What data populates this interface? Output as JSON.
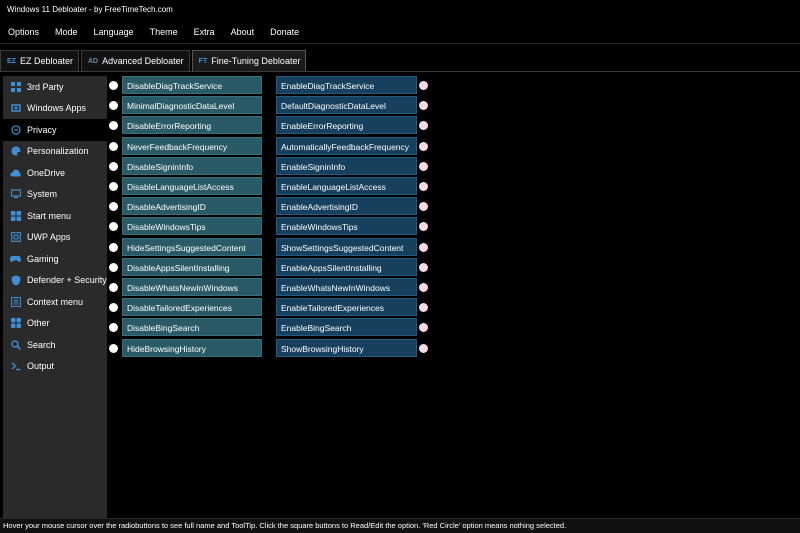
{
  "window": {
    "title": "Windows 11 Debloater - by FreeTimeTech.com"
  },
  "menu": [
    "Options",
    "Mode",
    "Language",
    "Theme",
    "Extra",
    "About",
    "Donate"
  ],
  "tabs": [
    {
      "icon": "EZ",
      "label": "EZ Debloater",
      "active": false
    },
    {
      "icon": "AD",
      "label": "Advanced Debloater",
      "active": false
    },
    {
      "icon": "FT",
      "label": "Fine-Tuning Debloater",
      "active": true
    }
  ],
  "sidebar": {
    "items": [
      {
        "label": "3rd Party",
        "icon": "apps-icon",
        "active": false
      },
      {
        "label": "Windows Apps",
        "icon": "windows-apps-icon",
        "active": false
      },
      {
        "label": "Privacy",
        "icon": "privacy-icon",
        "active": true
      },
      {
        "label": "Personalization",
        "icon": "personalization-icon",
        "active": false
      },
      {
        "label": "OneDrive",
        "icon": "cloud-icon",
        "active": false
      },
      {
        "label": "System",
        "icon": "system-icon",
        "active": false
      },
      {
        "label": "Start menu",
        "icon": "start-menu-icon",
        "active": false
      },
      {
        "label": "UWP Apps",
        "icon": "uwp-apps-icon",
        "active": false
      },
      {
        "label": "Gaming",
        "icon": "gamepad-icon",
        "active": false
      },
      {
        "label": "Defender + Security",
        "icon": "shield-icon",
        "active": false
      },
      {
        "label": "Context menu",
        "icon": "context-menu-icon",
        "active": false
      },
      {
        "label": "Other",
        "icon": "other-icon",
        "active": false
      },
      {
        "label": "Search",
        "icon": "search-icon",
        "active": false
      },
      {
        "label": "Output",
        "icon": "output-icon",
        "active": false
      }
    ]
  },
  "options": [
    {
      "disable": "DisableDiagTrackService",
      "enable": "EnableDiagTrackService"
    },
    {
      "disable": "MinimalDiagnosticDataLevel",
      "enable": "DefaultDiagnosticDataLevel"
    },
    {
      "disable": "DisableErrorReporting",
      "enable": "EnableErrorReporting"
    },
    {
      "disable": "NeverFeedbackFrequency",
      "enable": "AutomaticallyFeedbackFrequency"
    },
    {
      "disable": "DisableSigninInfo",
      "enable": "EnableSigninInfo"
    },
    {
      "disable": "DisableLanguageListAccess",
      "enable": "EnableLanguageListAccess"
    },
    {
      "disable": "DisableAdvertisingID",
      "enable": "EnableAdvertisingID"
    },
    {
      "disable": "DisableWindowsTips",
      "enable": "EnableWindowsTips"
    },
    {
      "disable": "HideSettingsSuggestedContent",
      "enable": "ShowSettingsSuggestedContent"
    },
    {
      "disable": "DisableAppsSilentInstalling",
      "enable": "EnableAppsSilentInstalling"
    },
    {
      "disable": "DisableWhatsNewInWindows",
      "enable": "EnableWhatsNewInWindows"
    },
    {
      "disable": "DisableTailoredExperiences",
      "enable": "EnableTailoredExperiences"
    },
    {
      "disable": "DisableBingSearch",
      "enable": "EnableBingSearch"
    },
    {
      "disable": "HideBrowsingHistory",
      "enable": "ShowBrowsingHistory"
    }
  ],
  "status": {
    "text": "Hover your mouse cursor over the radiobuttons to see full name and ToolTip. Click the square buttons to Read/Edit the option. 'Red Circle' option means nothing selected."
  },
  "colors": {
    "accent": "#3f8fd6",
    "disable_button": "#2a5a66",
    "enable_button": "#16405e",
    "sidebar_bg": "#2a2a2a"
  }
}
